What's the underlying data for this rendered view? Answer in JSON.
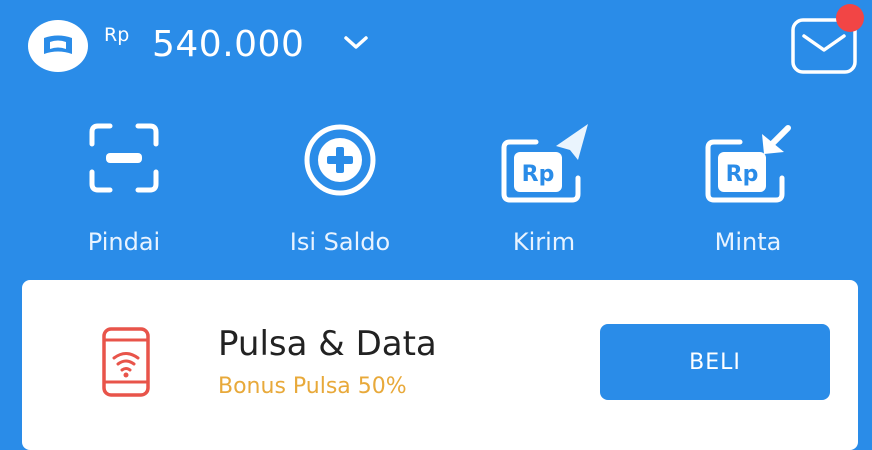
{
  "header": {
    "currency": "Rp",
    "balance": "540.000",
    "wallet_icon": "wallet-icon",
    "dropdown_icon": "chevron-down-icon",
    "inbox_icon": "mail-icon",
    "has_notification": true
  },
  "actions": [
    {
      "label": "Pindai",
      "icon": "scan-icon"
    },
    {
      "label": "Isi Saldo",
      "icon": "plus-circle-icon"
    },
    {
      "label": "Kirim",
      "icon": "send-money-icon"
    },
    {
      "label": "Minta",
      "icon": "request-money-icon"
    }
  ],
  "card": {
    "title": "Pulsa & Data",
    "subtitle": "Bonus Pulsa 50%",
    "button_label": "BELI",
    "icon": "phone-signal-icon"
  },
  "colors": {
    "primary": "#2a8ce8",
    "accent_orange": "#e8a93a",
    "notification": "#f24545",
    "phone_icon": "#e8544a"
  }
}
